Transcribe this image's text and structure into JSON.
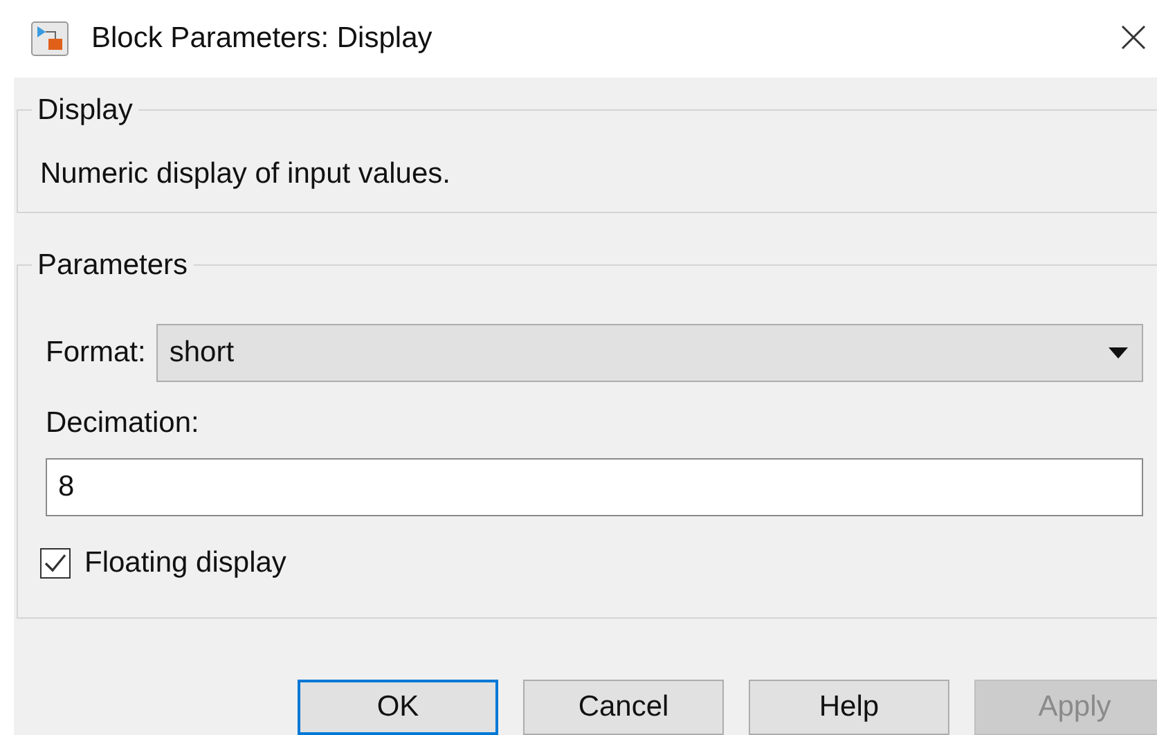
{
  "window": {
    "title": "Block Parameters: Display"
  },
  "description_group": {
    "title": "Display",
    "text": "Numeric display of input values."
  },
  "parameters_group": {
    "title": "Parameters",
    "format": {
      "label": "Format:",
      "value": "short"
    },
    "decimation": {
      "label": "Decimation:",
      "value": "8"
    },
    "floating_display": {
      "label": "Floating display",
      "checked": true
    }
  },
  "buttons": [
    {
      "label": "OK",
      "focused": true,
      "disabled": false
    },
    {
      "label": "Cancel",
      "focused": false,
      "disabled": false
    },
    {
      "label": "Help",
      "focused": false,
      "disabled": false
    },
    {
      "label": "Apply",
      "focused": false,
      "disabled": true
    }
  ]
}
